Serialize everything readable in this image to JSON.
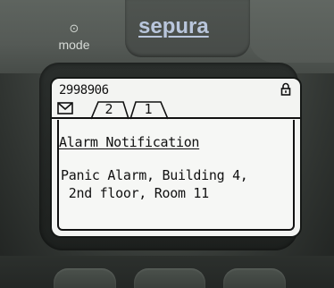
{
  "device": {
    "brand": "sepura",
    "mode_icon": "power-ring-icon",
    "mode_glyph": "⊙",
    "mode_label": "mode"
  },
  "status_bar": {
    "caller_id": "2998906",
    "lock_icon": "padlock-icon"
  },
  "tabs": {
    "envelope_icon": "envelope-icon",
    "items": [
      {
        "label": "2",
        "active": true
      },
      {
        "label": "1",
        "active": false
      }
    ]
  },
  "message": {
    "title": "Alarm Notification",
    "body": "Panic Alarm, Building 4,\n 2nd floor, Room 11"
  },
  "colors": {
    "screen_bg": "#f3f4f2",
    "text": "#111111",
    "logo": "#b9c6dc",
    "housing": "#4a4f4b"
  }
}
